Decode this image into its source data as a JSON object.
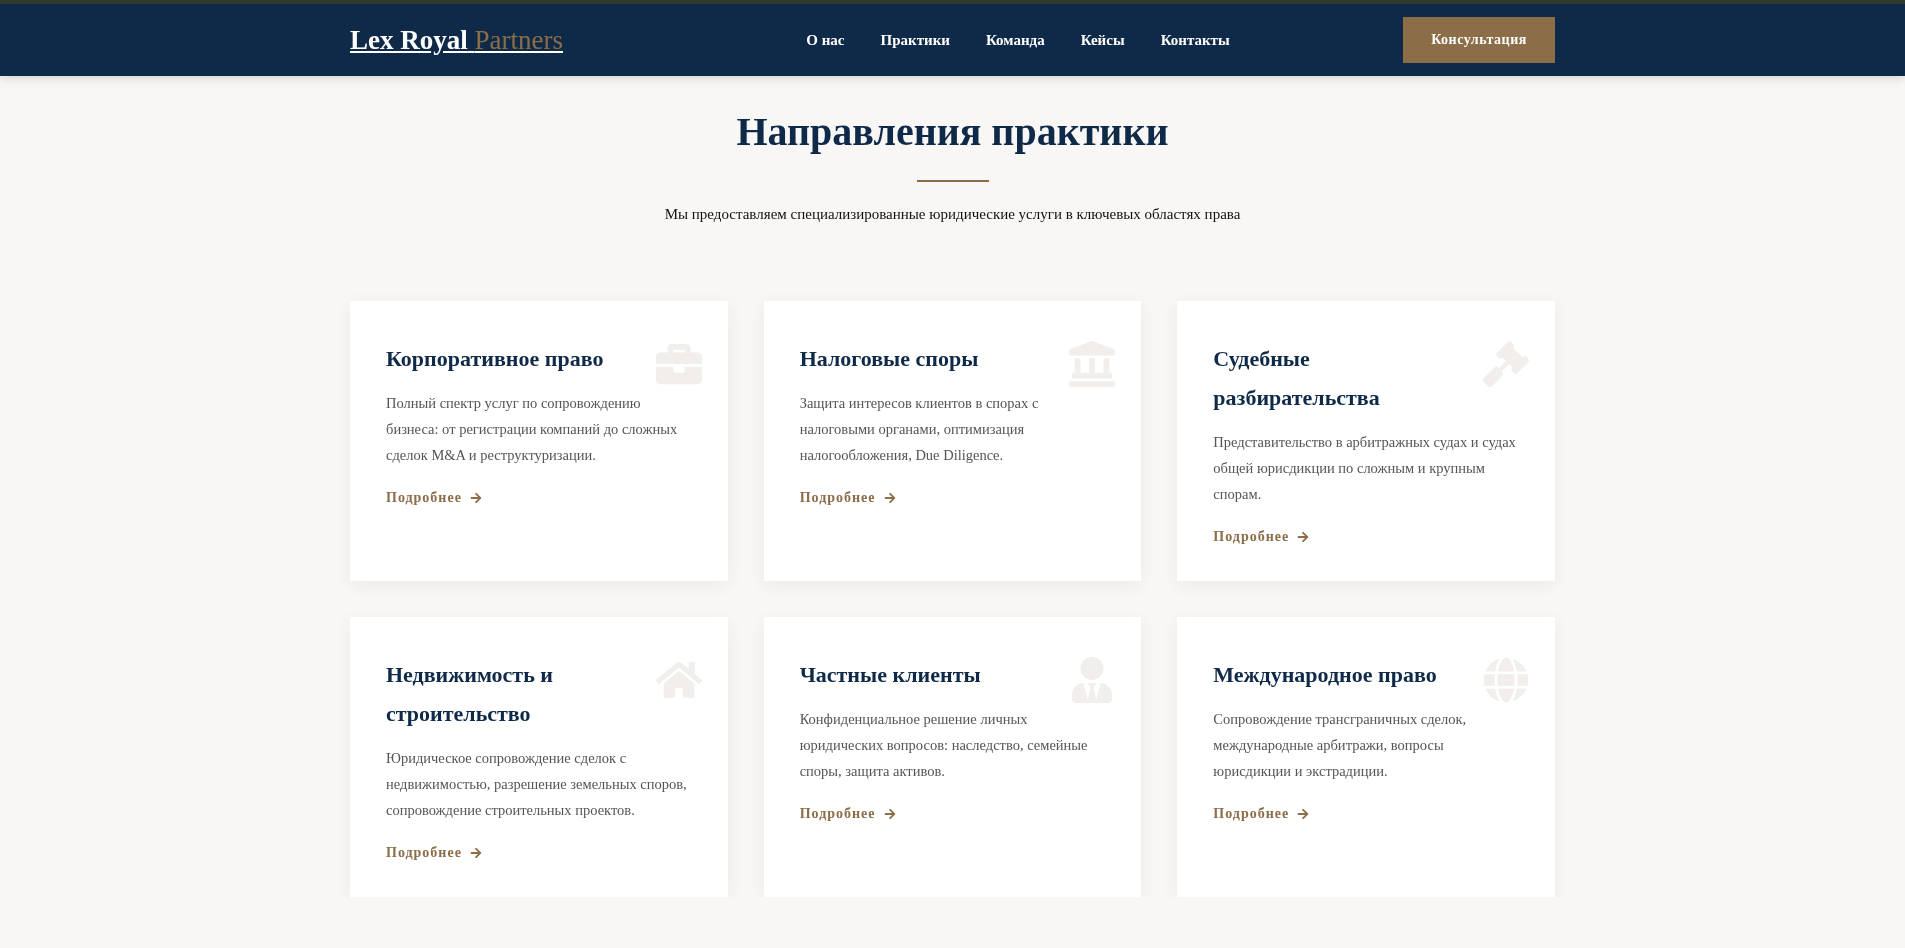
{
  "header": {
    "logo": {
      "primary": "Lex Royal",
      "accent": "Partners"
    },
    "nav": [
      "О нас",
      "Практики",
      "Команда",
      "Кейсы",
      "Контакты"
    ],
    "cta": "Консультация"
  },
  "section": {
    "title": "Направления практики",
    "subtitle": "Мы предоставляем специализированные юридические услуги в ключевых областях права"
  },
  "cards": [
    {
      "title": "Корпоративное право",
      "text": "Полный спектр услуг по сопровождению бизнеса: от регистрации компаний до сложных сделок M&A и реструктуризации.",
      "link": "Подробнее"
    },
    {
      "title": "Налоговые споры",
      "text": "Защита интересов клиентов в спорах с налоговыми органами, оптимизация налогообложения, Due Diligence.",
      "link": "Подробнее"
    },
    {
      "title": "Судебные разбирательства",
      "text": "Представительство в арбитражных судах и судах общей юрисдикции по сложным и крупным спорам.",
      "link": "Подробнее"
    },
    {
      "title": "Недвижимость и строительство",
      "text": "Юридическое сопровождение сделок с недвижимостью, разрешение земельных споров, сопровождение строительных проектов.",
      "link": "Подробнее"
    },
    {
      "title": "Частные клиенты",
      "text": "Конфиденциальное решение личных юридических вопросов: наследство, семейные споры, защита активов.",
      "link": "Подробнее"
    },
    {
      "title": "Международное право",
      "text": "Сопровождение трансграничных сделок, международные арбитражи, вопросы юрисдикции и экстрадиции.",
      "link": "Подробнее"
    }
  ]
}
